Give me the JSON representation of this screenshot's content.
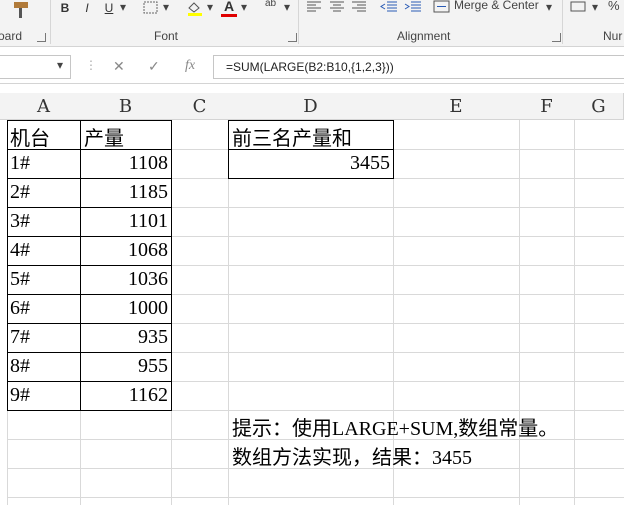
{
  "ribbon": {
    "bold": "B",
    "italic": "I",
    "underline": "U",
    "font_color_letter": "A",
    "abc_label": "ab",
    "merge_center": "Merge & Center",
    "percent": "%",
    "clipboard_group": "oard",
    "font_group": "Font",
    "alignment_group": "Alignment",
    "number_group": "Nur",
    "fill_color": "#ffff00",
    "font_color": "#e00000"
  },
  "formula_bar": {
    "fx": "fx",
    "formula": "=SUM(LARGE(B2:B10,{1,2,3}))"
  },
  "columns": [
    "A",
    "B",
    "C",
    "D",
    "E",
    "F",
    "G"
  ],
  "table": {
    "header_a": "机台",
    "header_b": "产量",
    "rows": [
      {
        "machine": "1#",
        "output": "1108"
      },
      {
        "machine": "2#",
        "output": "1185"
      },
      {
        "machine": "3#",
        "output": "1101"
      },
      {
        "machine": "4#",
        "output": "1068"
      },
      {
        "machine": "5#",
        "output": "1036"
      },
      {
        "machine": "6#",
        "output": "1000"
      },
      {
        "machine": "7#",
        "output": "935"
      },
      {
        "machine": "8#",
        "output": "955"
      },
      {
        "machine": "9#",
        "output": "1162"
      }
    ]
  },
  "result": {
    "label": "前三名产量和",
    "value": "3455"
  },
  "notes": {
    "line1": "提示：使用LARGE+SUM,数组常量。",
    "line2": "数组方法实现，结果：3455"
  }
}
